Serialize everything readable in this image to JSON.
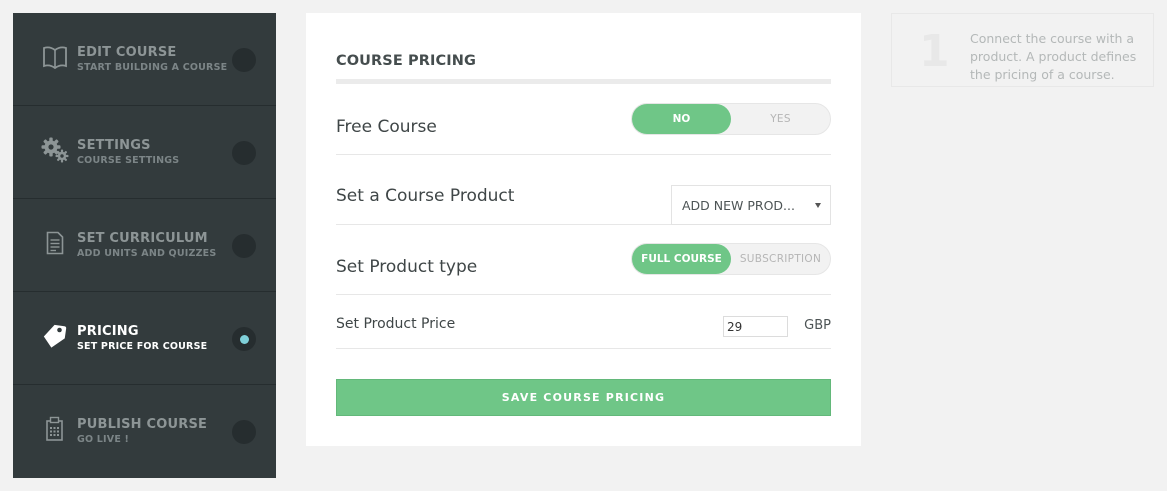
{
  "sidebar": {
    "steps": [
      {
        "title": "EDIT COURSE",
        "subtitle": "START BUILDING A COURSE",
        "icon": "book-icon",
        "active": false
      },
      {
        "title": "SETTINGS",
        "subtitle": "COURSE SETTINGS",
        "icon": "gears-icon",
        "active": false
      },
      {
        "title": "SET CURRICULUM",
        "subtitle": "ADD UNITS AND QUIZZES",
        "icon": "document-icon",
        "active": false
      },
      {
        "title": "PRICING",
        "subtitle": "SET PRICE FOR COURSE",
        "icon": "price-tag-icon",
        "active": true
      },
      {
        "title": "PUBLISH COURSE",
        "subtitle": "GO LIVE !",
        "icon": "clipboard-icon",
        "active": false
      }
    ]
  },
  "card": {
    "title": "COURSE PRICING",
    "free_course": {
      "label": "Free Course",
      "options": [
        "NO",
        "YES"
      ],
      "selected": "NO"
    },
    "course_product": {
      "label": "Set a Course Product",
      "selected": "ADD NEW PROD..."
    },
    "product_type": {
      "label": "Set Product type",
      "options": [
        "FULL COURSE",
        "SUBSCRIPTION"
      ],
      "selected": "FULL COURSE"
    },
    "product_price": {
      "label": "Set Product Price",
      "value": "29",
      "currency": "GBP"
    },
    "save_label": "SAVE COURSE PRICING"
  },
  "hint": {
    "number": "1",
    "text": "Connect the course with a product. A product defines the pricing of a course."
  },
  "colors": {
    "sidebar_bg": "#333b3d",
    "accent_green": "#6fc687",
    "active_dot": "#7fd0d9",
    "page_bg": "#f2f2f2"
  }
}
